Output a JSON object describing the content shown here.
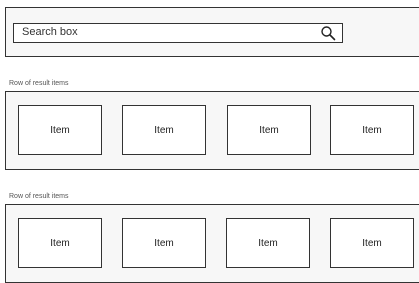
{
  "search": {
    "placeholder": "Search box",
    "icon": "search-icon"
  },
  "rows": [
    {
      "label": "Row of result items",
      "items": [
        "Item",
        "Item",
        "Item",
        "Item"
      ]
    },
    {
      "label": "Row of result items",
      "items": [
        "Item",
        "Item",
        "Item",
        "Item"
      ]
    }
  ]
}
